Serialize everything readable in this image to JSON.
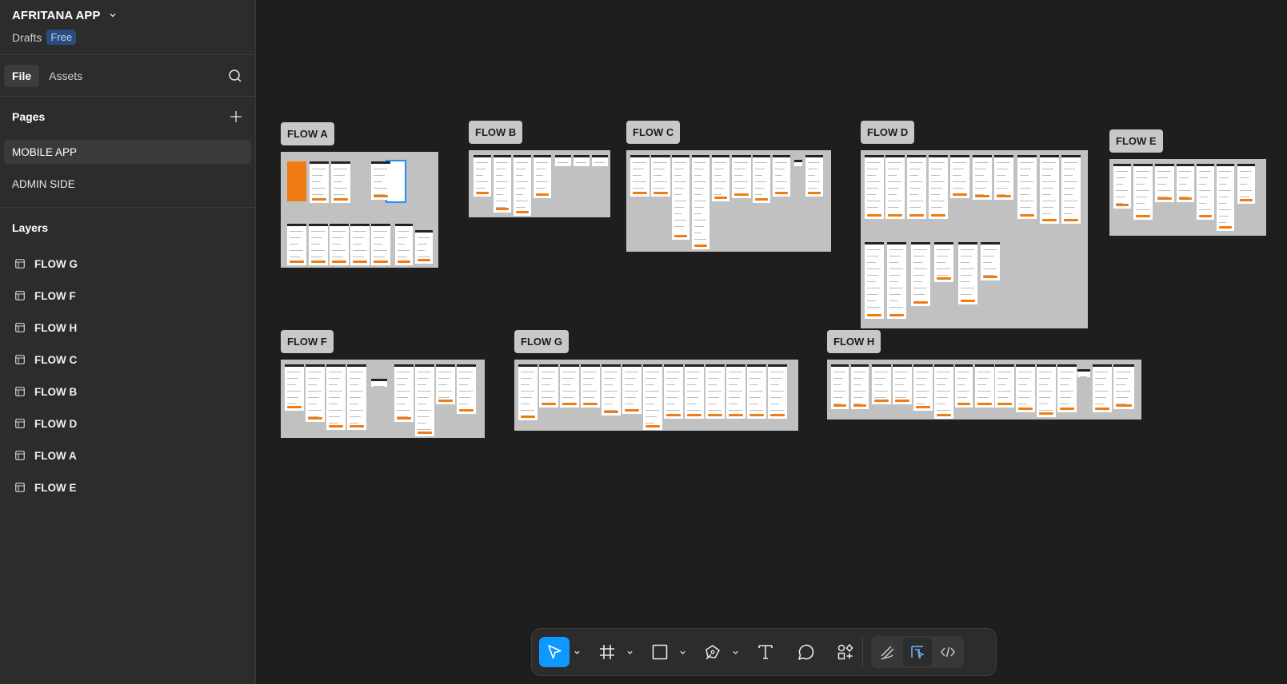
{
  "file": {
    "title": "AFRITANA APP",
    "location": "Drafts",
    "plan": "Free"
  },
  "tabs": {
    "file": "File",
    "assets": "Assets"
  },
  "pages": {
    "heading": "Pages",
    "items": [
      "MOBILE APP",
      "ADMIN SIDE"
    ]
  },
  "layers": {
    "heading": "Layers",
    "items": [
      "FLOW G",
      "FLOW F",
      "FLOW H",
      "FLOW C",
      "FLOW B",
      "FLOW D",
      "FLOW A",
      "FLOW E"
    ]
  },
  "flows": {
    "a": "FLOW A",
    "b": "FLOW B",
    "c": "FLOW C",
    "d": "FLOW D",
    "e": "FLOW E",
    "f": "FLOW F",
    "g": "FLOW G",
    "h": "FLOW H"
  },
  "colors": {
    "accent": "#0d99ff",
    "brand_orange": "#f07b13",
    "badge_bg": "#2a4b7c"
  },
  "toolbar": {
    "tools": [
      "move-icon",
      "frame-icon",
      "rectangle-icon",
      "pen-icon",
      "text-icon",
      "comment-icon",
      "actions-icon"
    ],
    "modes": [
      "draw-mode-icon",
      "design-mode-icon",
      "dev-mode-icon"
    ]
  }
}
